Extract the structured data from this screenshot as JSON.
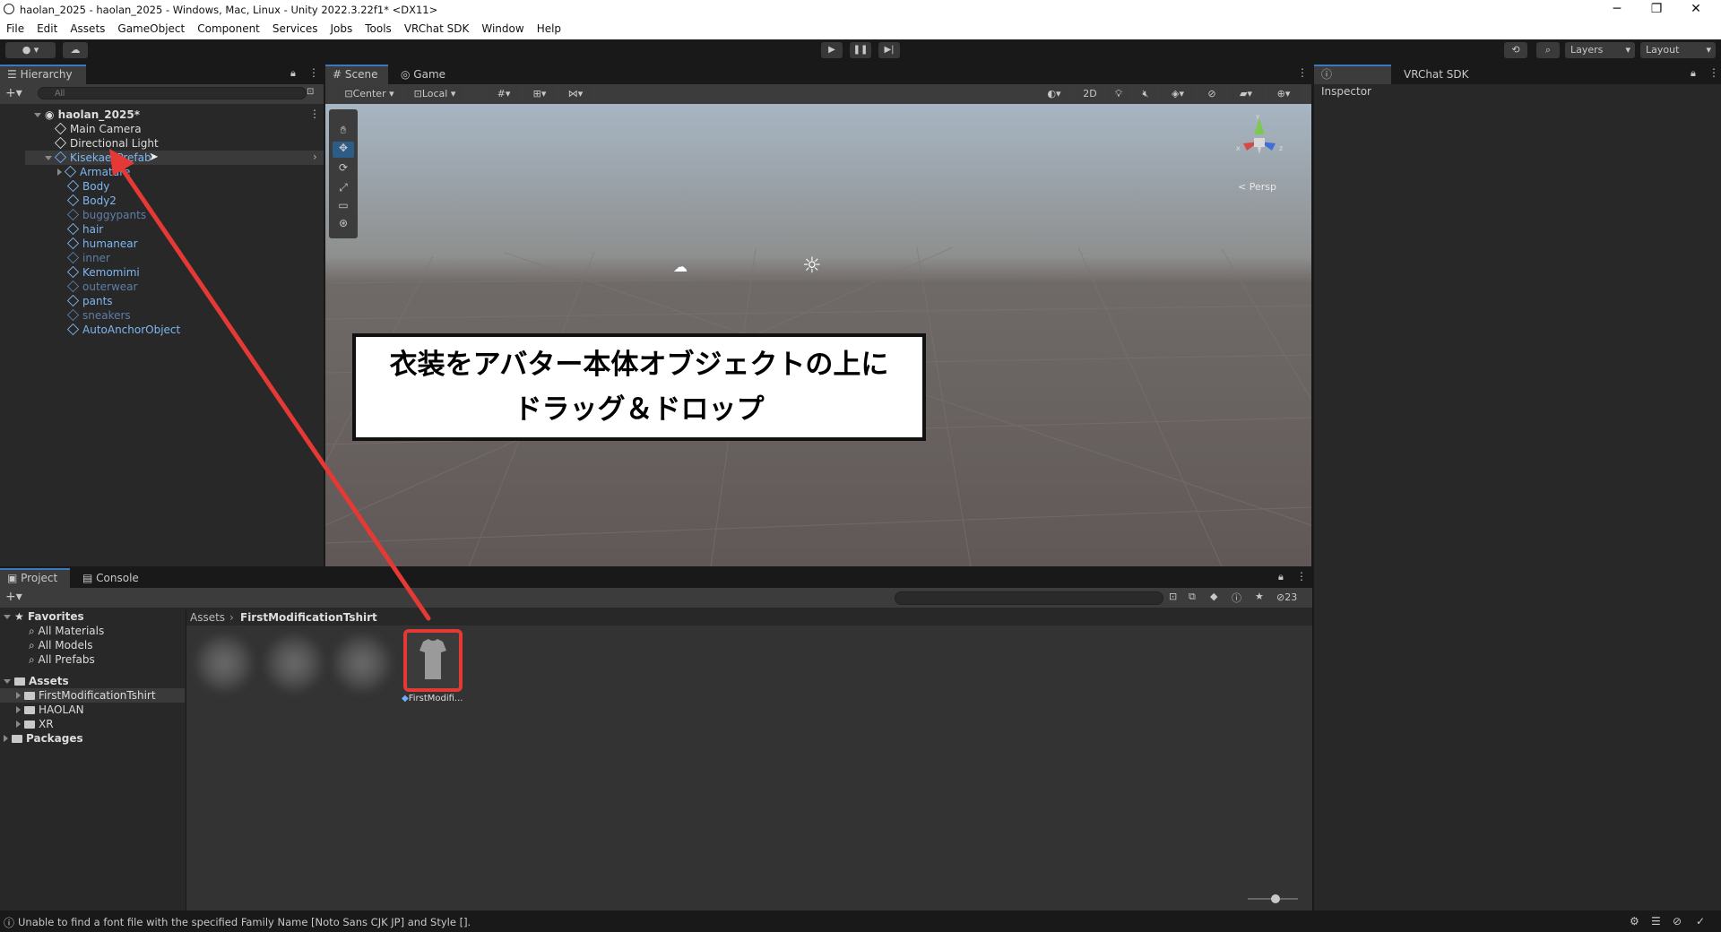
{
  "window": {
    "title": "haolan_2025 - haolan_2025 - Windows, Mac, Linux - Unity 2022.3.22f1* <DX11>",
    "minimize": "─",
    "restore": "❐",
    "close": "✕"
  },
  "menu": [
    "File",
    "Edit",
    "Assets",
    "GameObject",
    "Component",
    "Services",
    "Jobs",
    "Tools",
    "VRChat SDK",
    "Window",
    "Help"
  ],
  "toolbar": {
    "layers_label": "Layers",
    "layout_label": "Layout"
  },
  "hierarchy": {
    "tab_label": "Hierarchy",
    "search_placeholder": "All",
    "scene_name": "haolan_2025*",
    "items": [
      {
        "label": "Main Camera"
      },
      {
        "label": "Directional Light"
      },
      {
        "label": "Kisekae_Prefab"
      },
      {
        "label": "Armature"
      },
      {
        "label": "Body"
      },
      {
        "label": "Body2"
      },
      {
        "label": "buggypants"
      },
      {
        "label": "hair"
      },
      {
        "label": "humanear"
      },
      {
        "label": "inner"
      },
      {
        "label": "Kemomimi"
      },
      {
        "label": "outerwear"
      },
      {
        "label": "pants"
      },
      {
        "label": "sneakers"
      },
      {
        "label": "AutoAnchorObject"
      }
    ]
  },
  "scene": {
    "tabs": [
      "Scene",
      "Game"
    ],
    "pivot_label": "Center",
    "space_label": "Local",
    "mode_2d": "2D",
    "persp_label": "< Persp",
    "annotation_line1": "衣装をアバター本体オブジェクトの上に",
    "annotation_line2": "ドラッグ＆ドロップ"
  },
  "inspector": {
    "tabs": [
      "Inspector",
      "VRChat SDK"
    ]
  },
  "project": {
    "tabs": [
      "Project",
      "Console"
    ],
    "hidden_count": "23",
    "breadcrumb": [
      "Assets",
      "FirstModificationTshirt"
    ],
    "favorites_label": "Favorites",
    "favorites": [
      "All Materials",
      "All Models",
      "All Prefabs"
    ],
    "assets_label": "Assets",
    "folders": [
      "FirstModificationTshirt",
      "HAOLAN",
      "XR"
    ],
    "packages_label": "Packages",
    "asset_item_label": "FirstModifi..."
  },
  "status": {
    "message": "Unable to find a font file with the specified Family Name [Noto Sans CJK JP] and Style []."
  },
  "colors": {
    "accent_red": "#e53935",
    "selection_blue": "#2c5d87",
    "prefab_blue": "#7fb6f2"
  }
}
